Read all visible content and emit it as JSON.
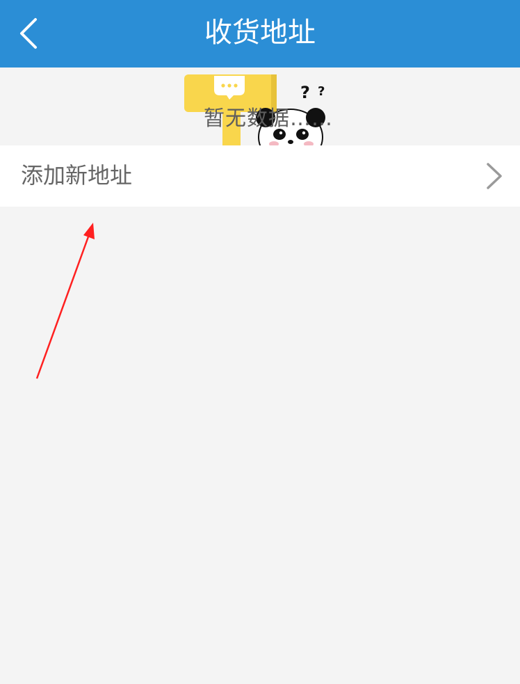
{
  "header": {
    "title": "收货地址",
    "back_icon": "chevron-left-icon",
    "background_color": "#2b8ed6"
  },
  "empty_state": {
    "message": "暂无数据……",
    "illustration": "panda-with-sign-illustration"
  },
  "address_list": {
    "add_label": "添加新地址",
    "add_icon": "chevron-right-icon"
  },
  "annotation": {
    "color": "#ff2020",
    "icon": "red-arrow-annotation"
  }
}
